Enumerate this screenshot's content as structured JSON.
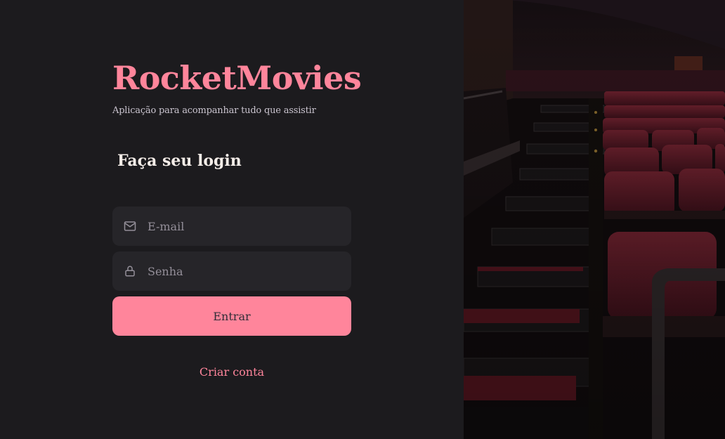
{
  "brand": {
    "title": "RocketMovies",
    "tagline": "Aplicação para acompanhar tudo que assistir"
  },
  "login": {
    "title": "Faça seu login",
    "email_placeholder": "E-mail",
    "email_value": "",
    "password_placeholder": "Senha",
    "password_value": "",
    "submit_label": "Entrar",
    "create_account_label": "Criar conta"
  },
  "icons": {
    "email": "mail-icon",
    "password": "lock-icon"
  },
  "colors": {
    "background": "#1c1b1e",
    "accent": "#ff859b",
    "input_background": "#262529",
    "placeholder": "#948f99",
    "button_text": "#312e38"
  },
  "background_image": "cinema-seats-photo"
}
